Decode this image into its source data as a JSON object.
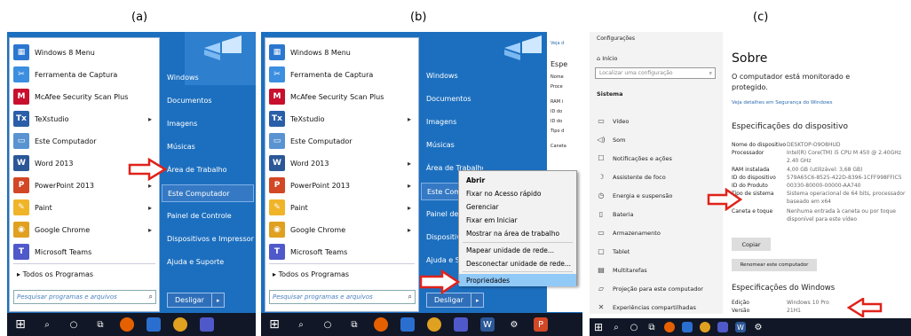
{
  "labels": {
    "a": "(a)",
    "b": "(b)",
    "c": "(c)"
  },
  "start_menu": {
    "programs": [
      {
        "label": "Windows 8 Menu",
        "icon": "windows8-menu-icon",
        "color": "#2b77d0",
        "glyph": "▦",
        "arrow": false
      },
      {
        "label": "Ferramenta de Captura",
        "icon": "snipping-tool-icon",
        "color": "#3b8ee0",
        "glyph": "✂",
        "arrow": false
      },
      {
        "label": "McAfee Security Scan Plus",
        "icon": "mcafee-icon",
        "color": "#c8102e",
        "glyph": "M",
        "arrow": false
      },
      {
        "label": "TeXstudio",
        "icon": "texstudio-icon",
        "color": "#2a5ea8",
        "glyph": "Tx",
        "arrow": true
      },
      {
        "label": "Este Computador",
        "icon": "computer-icon",
        "color": "#5a93d1",
        "glyph": "▭",
        "arrow": false
      },
      {
        "label": "Word 2013",
        "icon": "word-icon",
        "color": "#2b5797",
        "glyph": "W",
        "arrow": true
      },
      {
        "label": "PowerPoint 2013",
        "icon": "powerpoint-icon",
        "color": "#d24726",
        "glyph": "P",
        "arrow": true
      },
      {
        "label": "Paint",
        "icon": "paint-icon",
        "color": "#f0b429",
        "glyph": "✎",
        "arrow": true
      },
      {
        "label": "Google Chrome",
        "icon": "chrome-icon",
        "color": "#e0a020",
        "glyph": "◉",
        "arrow": true
      },
      {
        "label": "Microsoft Teams",
        "icon": "teams-icon",
        "color": "#5059c9",
        "glyph": "T",
        "arrow": false
      }
    ],
    "all_programs": "Todos os Programas",
    "search_placeholder": "Pesquisar programas e arquivos",
    "right_items": [
      "Windows",
      "Documentos",
      "Imagens",
      "Músicas",
      "Área de Trabalho",
      "Este Computador",
      "Painel de Controle",
      "Dispositivos e Impressoras",
      "Ajuda e Suporte"
    ],
    "right_items_b": [
      "Windows",
      "Documentos",
      "Imagens",
      "Músicas",
      "Área de Trabalho",
      "Este Comp",
      "Painel de",
      "Dispositiv",
      "Ajuda e S"
    ],
    "shutdown": "Desligar"
  },
  "context_menu": {
    "items": [
      "Abrir",
      "Fixar no Acesso rápido",
      "Gerenciar",
      "Fixar em Iniciar",
      "Mostrar na área de trabalho",
      "Mapear unidade de rede...",
      "Desconectar unidade de rede...",
      "Propriedades"
    ]
  },
  "background_window_b": {
    "link": "Veja d",
    "heading": "Espe",
    "lines": [
      "Nome",
      "Proce",
      "RAM i",
      "ID do",
      "ID do",
      "Tipo d",
      "Caneta"
    ]
  },
  "settings": {
    "window_title": "Configurações",
    "home": "Início",
    "search_placeholder": "Localizar uma configuração",
    "section": "Sistema",
    "nav": [
      {
        "icon": "display-icon",
        "glyph": "▭",
        "label": "Vídeo"
      },
      {
        "icon": "sound-icon",
        "glyph": "◁)",
        "label": "Som"
      },
      {
        "icon": "notifications-icon",
        "glyph": "☐",
        "label": "Notificações e ações"
      },
      {
        "icon": "focus-assist-icon",
        "glyph": "☽",
        "label": "Assistente de foco"
      },
      {
        "icon": "power-icon",
        "glyph": "◷",
        "label": "Energia e suspensão"
      },
      {
        "icon": "battery-icon",
        "glyph": "▯",
        "label": "Bateria"
      },
      {
        "icon": "storage-icon",
        "glyph": "▭",
        "label": "Armazenamento"
      },
      {
        "icon": "tablet-icon",
        "glyph": "▢",
        "label": "Tablet"
      },
      {
        "icon": "multitasking-icon",
        "glyph": "▤",
        "label": "Multitarefas"
      },
      {
        "icon": "projecting-icon",
        "glyph": "▱",
        "label": "Projeção para este computador"
      },
      {
        "icon": "shared-experiences-icon",
        "glyph": "✕",
        "label": "Experiências compartilhadas"
      }
    ],
    "title": "Sobre",
    "monitor_line1": "O computador está monitorado e",
    "monitor_line2": "protegido.",
    "security_link": "Veja detalhes em Segurança do Windows",
    "device_specs_heading": "Especificações do dispositivo",
    "specs": [
      {
        "k": "Nome do dispositivo",
        "v": "DESKTOP-O9O8HUD"
      },
      {
        "k": "Processador",
        "v": "Intel(R) Core(TM) i5 CPU     M 450  @ 2.40GHz"
      },
      {
        "k": "",
        "v": "2.40 GHz"
      },
      {
        "k": "RAM instalada",
        "v": "4,00 GB (utilizável: 3,68 GB)"
      },
      {
        "k": "ID do dispositivo",
        "v": "579A65C6-8525-422D-8396-1CFF998FFIC5"
      },
      {
        "k": "ID do Produto",
        "v": "00330-80000-00000-AA740"
      },
      {
        "k": "Tipo de sistema",
        "v": "Sistema operacional de 64 bits, processador"
      },
      {
        "k": "",
        "v": "baseado em x64"
      },
      {
        "k": "Caneta e toque",
        "v": "Nenhuma entrada à caneta ou por toque"
      },
      {
        "k": "",
        "v": "disponível para este vídeo"
      }
    ],
    "copy_button": "Copiar",
    "rename_button": "Renomear este computador",
    "windows_specs_heading": "Especificações do Windows",
    "edition_label": "Edição",
    "edition_value": "Windows 10 Pro",
    "version_label": "Versão",
    "version_value": "21H1"
  },
  "colors": {
    "desktop": "#1c6fbf",
    "taskbar": "#111726",
    "arrow_red": "#e0221a",
    "highlight": "#3579c4",
    "context_highlight": "#91c9f7"
  }
}
